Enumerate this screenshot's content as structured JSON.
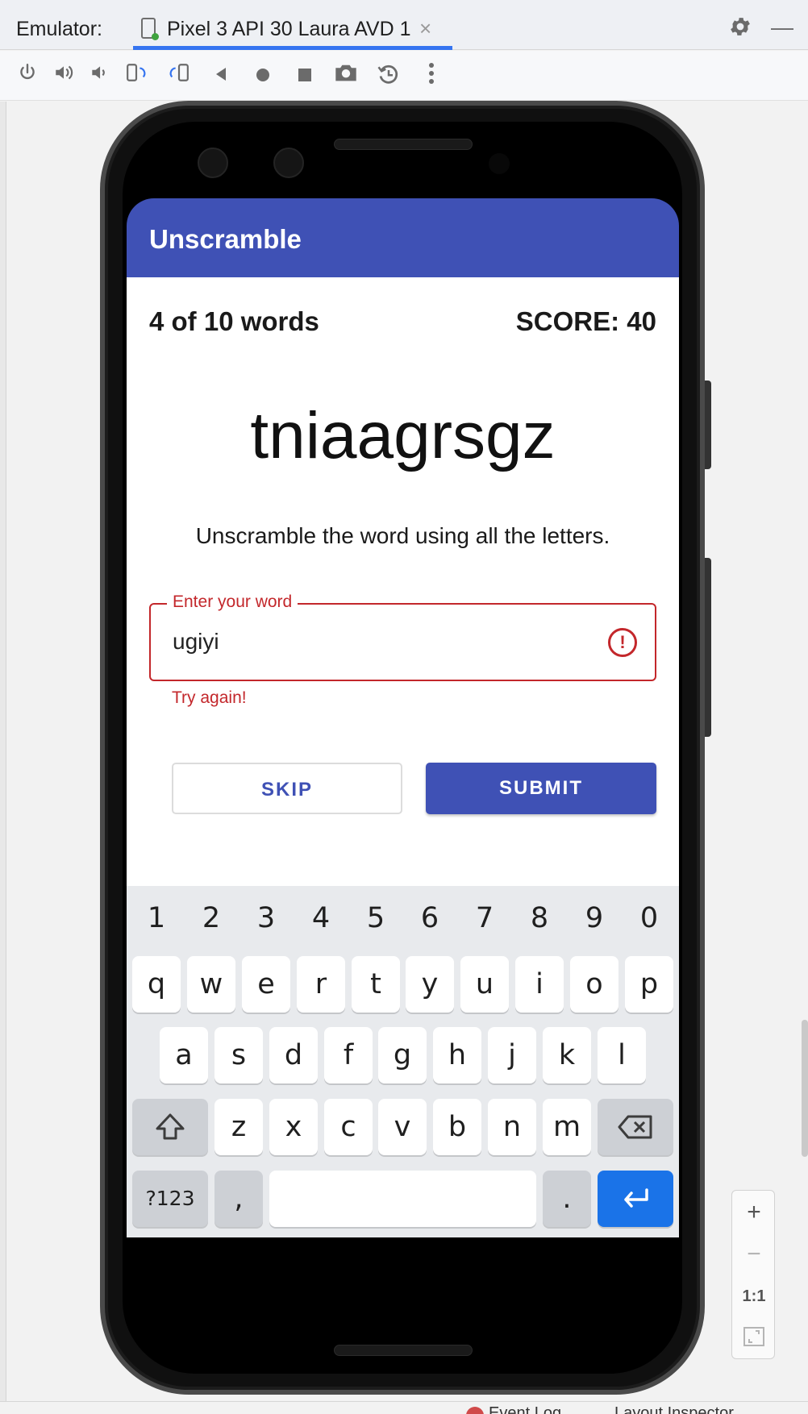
{
  "ide": {
    "panel_label": "Emulator:",
    "tab_title": "Pixel 3 API 30 Laura AVD 1",
    "tab_close": "×",
    "settings_icon": "gear-icon",
    "minimize_symbol": "—",
    "accent": "#3574f0",
    "toolbar_icons": [
      "power-icon",
      "volume-up-icon",
      "volume-down-icon",
      "rotate-left-icon",
      "rotate-right-icon",
      "back-icon",
      "home-icon",
      "overview-icon",
      "camera-icon",
      "snapshot-icon",
      "more-vert-icon"
    ],
    "status": {
      "event_log": "Event Log",
      "layout_inspector": "Layout Inspector"
    }
  },
  "zoom": {
    "plus": "+",
    "minus": "−",
    "one_to_one": "1:1",
    "fit_icon": "fit-screen-icon"
  },
  "app": {
    "title": "Unscramble",
    "brand_color": "#3f51b5",
    "error_color": "#c3272b",
    "word_count": "4 of 10 words",
    "score": "SCORE: 40",
    "scrambled_word": "tniaagrsgz",
    "instructions": "Unscramble the word using all the letters.",
    "input": {
      "label": "Enter your word",
      "value": "ugiyi",
      "error_icon": "error-icon",
      "helper_text": "Try again!"
    },
    "skip_label": "SKIP",
    "submit_label": "SUBMIT"
  },
  "keyboard": {
    "numbers": [
      "1",
      "2",
      "3",
      "4",
      "5",
      "6",
      "7",
      "8",
      "9",
      "0"
    ],
    "row1": [
      "q",
      "w",
      "e",
      "r",
      "t",
      "y",
      "u",
      "i",
      "o",
      "p"
    ],
    "row2": [
      "a",
      "s",
      "d",
      "f",
      "g",
      "h",
      "j",
      "k",
      "l"
    ],
    "row3": [
      "z",
      "x",
      "c",
      "v",
      "b",
      "n",
      "m"
    ],
    "symbols_key": "?123",
    "comma": ",",
    "period": ".",
    "shift_icon": "shift-icon",
    "backspace_icon": "backspace-icon",
    "enter_icon": "enter-icon",
    "enter_color": "#1a73e8"
  }
}
